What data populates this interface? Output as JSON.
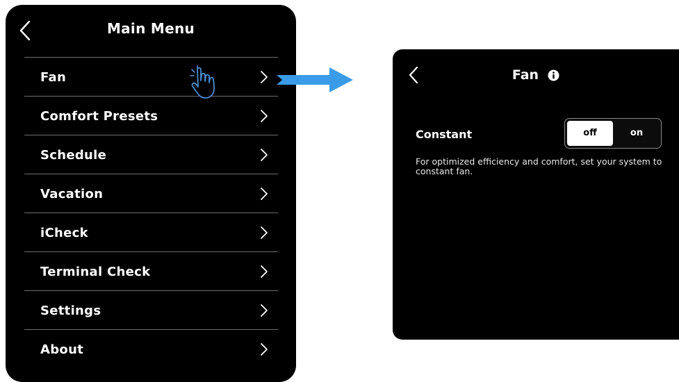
{
  "main_menu": {
    "title": "Main Menu",
    "back_icon": "chevron-left-icon",
    "items": [
      {
        "label": "Fan"
      },
      {
        "label": "Comfort Presets"
      },
      {
        "label": "Schedule"
      },
      {
        "label": "Vacation"
      },
      {
        "label": "iCheck"
      },
      {
        "label": "Terminal Check"
      },
      {
        "label": "Settings"
      },
      {
        "label": "About"
      }
    ],
    "item_icon": "chevron-right-icon",
    "pointer_icon": "hand-pointer-icon"
  },
  "arrow": {
    "icon": "arrow-right-icon",
    "color": "#3a9ce8"
  },
  "fan_screen": {
    "title": "Fan",
    "back_icon": "chevron-left-icon",
    "info_icon": "info-icon",
    "setting": {
      "label": "Constant",
      "options": [
        "off",
        "on"
      ],
      "selected": "off",
      "description": "For optimized efficiency and comfort, set your system to constant fan."
    }
  },
  "colors": {
    "panel_bg": "#000000",
    "text": "#ffffff",
    "divider": "#6f6f6f",
    "accent_arrow": "#3a9ce8"
  }
}
